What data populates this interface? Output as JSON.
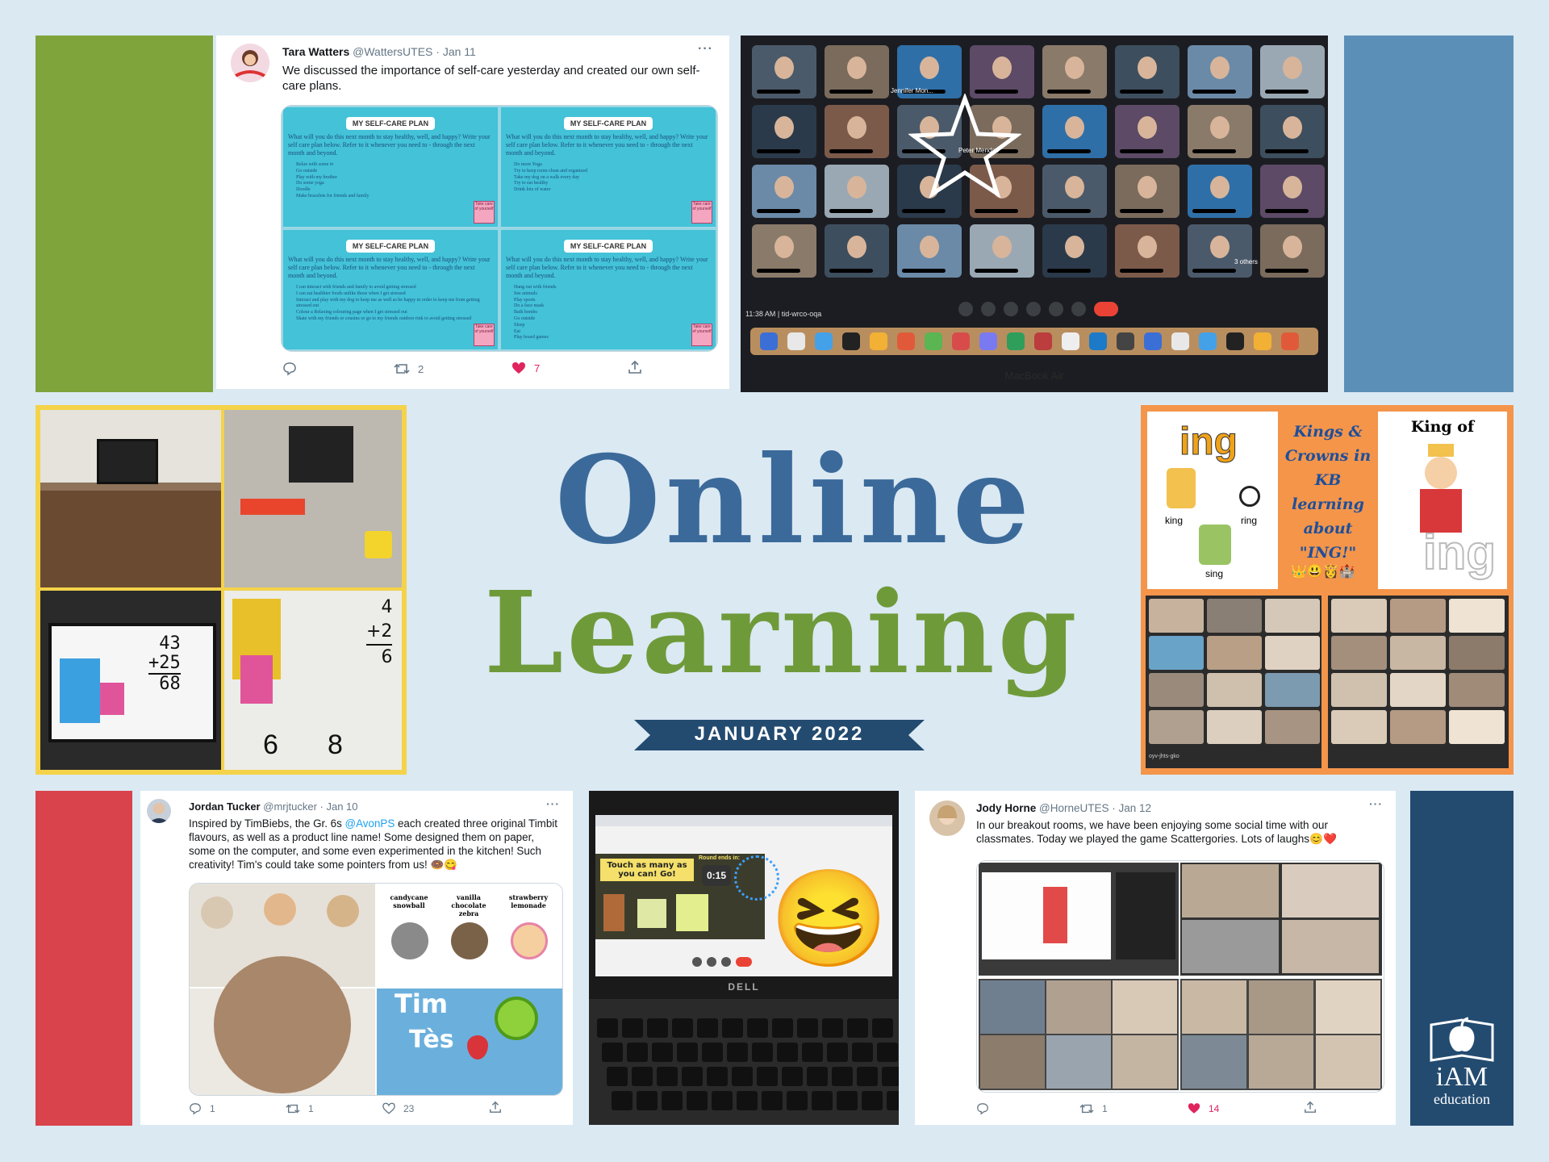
{
  "colors": {
    "background": "#dbe9f3",
    "green_block": "#7fa43c",
    "steel_block": "#5b8fb8",
    "red_block": "#d9434b",
    "navy_block": "#234b70",
    "ribbon": "#234b70",
    "yellow_border": "#f4d34a",
    "orange_border": "#f4954a",
    "heart": "#e0245e",
    "link": "#1da1f2"
  },
  "title": {
    "line1": "Online",
    "line2": "Learning",
    "date": "JANUARY 2022"
  },
  "logo": {
    "line1": "iAM",
    "line2": "education",
    "icon": "apple-book-icon"
  },
  "tweet1": {
    "name": "Tara Watters",
    "handle": "@WattersUTES",
    "date": "· Jan 11",
    "more": "···",
    "text": "We discussed the importance of self-care yesterday and created our own self-care plans.",
    "replies": "",
    "retweets": "2",
    "likes": "7",
    "plans": [
      {
        "title": "MY SELF-CARE PLAN",
        "prompt": "What will you do this next month to stay healthy, well, and happy? Write your self care plan below. Refer to it whenever you need to - through the next month and beyond.",
        "items": [
          "Relax with some tv",
          "Go outside",
          "Play with my brother",
          "Do some yoga",
          "Doodle",
          "Make bracelets for friends and family"
        ]
      },
      {
        "title": "MY SELF-CARE PLAN",
        "prompt": "What will you do this next month to stay healthy, well, and happy? Write your self care plan below. Refer to it whenever you need to - through the next month and beyond.",
        "items": [
          "Do more Yoga",
          "Try to keep room clean and organized",
          "Take my dog on a walk every day",
          "Try to eat healthy",
          "Drink lots of water"
        ]
      },
      {
        "title": "MY SELF-CARE PLAN",
        "prompt": "What will you do this next month to stay healthy, well, and happy? Write your self care plan below. Refer to it whenever you need to - through the next month and beyond.",
        "items": [
          "I can interact with friends and family to avoid getting stressed",
          "I can eat healthier foods unlike those when I get stressed",
          "Interact and play with my dog to keep me as well as be happy in order to keep me from getting stressed out",
          "Colour a Relaxing colouring page when I get stressed out",
          "Skate with my friends or cousins or go to my friends outdoor rink to avoid getting stressed"
        ]
      },
      {
        "title": "MY SELF-CARE PLAN",
        "prompt": "What will you do this next month to stay healthy, well, and happy? Write your self care plan below. Refer to it whenever you need to - through the next month and beyond.",
        "items": [
          "Hang out with friends",
          "See animals",
          "Play sports",
          "Do a face mask",
          "Bath bombs",
          "Go outside",
          "Sleep",
          "Eat",
          "Play board games"
        ]
      }
    ],
    "sticker": "Take care of yourself"
  },
  "zoom": {
    "names": [
      "Jennifer Mon...",
      "Peter Mendes",
      "3 others"
    ],
    "time": "11:38 AM",
    "meeting_code": "tid-wrco-oqa",
    "laptop_label": "MacBook Air"
  },
  "math": {
    "screen_sum": [
      "43",
      "+25",
      "68"
    ],
    "desk_sum": [
      "4",
      "+2",
      "6"
    ],
    "written_digits": [
      "6",
      "8"
    ]
  },
  "kings": {
    "ing_word": "ing",
    "words": [
      "king",
      "ring",
      "sing"
    ],
    "center_text": "Kings & Crowns in KB learning about \"ING!\"",
    "right_title": "King of",
    "right_ing": "ing",
    "meet_code": "oyv-jhts-gko"
  },
  "tweet2": {
    "name": "Jordan Tucker",
    "handle": "@mrjtucker",
    "date": "· Jan 10",
    "more": "···",
    "text_before": "Inspired by TimBiebs, the Gr. 6s ",
    "mention": "@AvonPS",
    "text_after": " each created three original Timbit flavours, as well as a product line name! Some designed them on paper, some on the computer, and some even experimented in the kitchen! Such creativity! Tim's could take some pointers from us! 🍩😋",
    "replies": "1",
    "retweets": "1",
    "likes": "23",
    "flavours": [
      "candycane snowball",
      "vanilla chocolate zebra",
      "strawberry lemonade"
    ],
    "brand": [
      "Tim",
      "Tès"
    ]
  },
  "game": {
    "prompt": "Touch as many as you can! Go!",
    "round_label": "Round ends in:",
    "timer": "0:15",
    "laptop_brand": "DELL",
    "emoji": "😆"
  },
  "tweet3": {
    "name": "Jody Horne",
    "handle": "@HorneUTES",
    "date": "· Jan 12",
    "more": "···",
    "text": "In our breakout rooms, we have been enjoying some social time with our classmates. Today we played the game Scattergories. Lots of laughs😊❤️",
    "replies": "",
    "retweets": "1",
    "likes": "14"
  }
}
